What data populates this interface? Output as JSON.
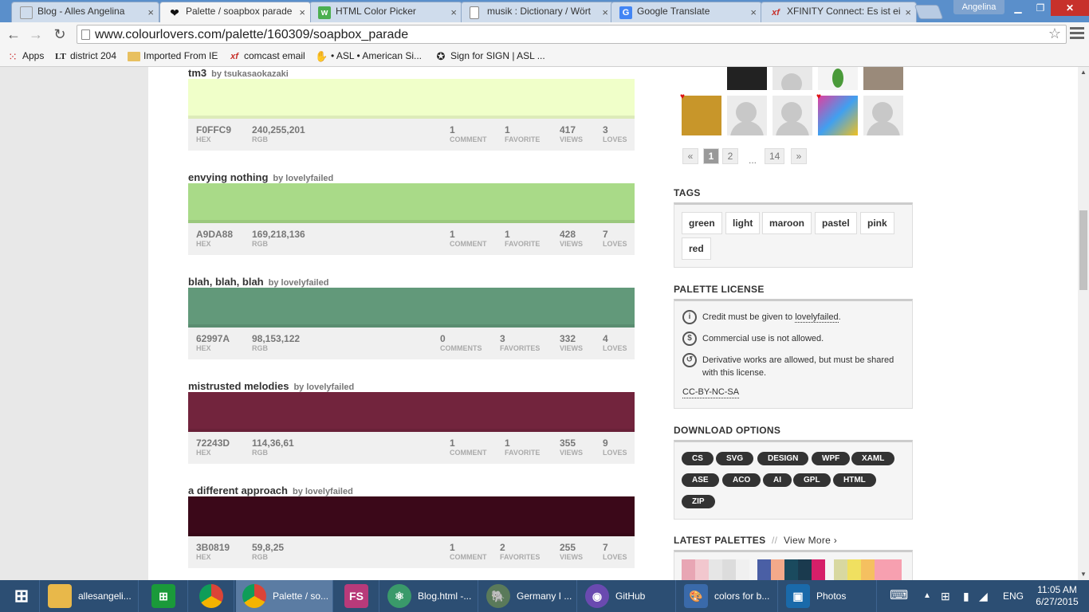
{
  "tabs": [
    {
      "label": "Blog - Alles Angelina",
      "icon": "blogger-icon",
      "color": "#f57d00"
    },
    {
      "label": "Palette / soapbox parade",
      "icon": "heart-icon",
      "color": "#222222",
      "active": true
    },
    {
      "label": "HTML Color Picker",
      "icon": "w3-icon",
      "color": "#4caf50"
    },
    {
      "label": "musik : Dictionary / Wört",
      "icon": "page-icon",
      "color": "#888888"
    },
    {
      "label": "Google Translate",
      "icon": "google-translate-icon",
      "color": "#4285f4"
    },
    {
      "label": "XFINITY Connect: Es ist ei",
      "icon": "xfinity-icon",
      "color": "#c7312b"
    }
  ],
  "profile_name": "Angelina",
  "url": "www.colourlovers.com/palette/160309/soapbox_parade",
  "bookmarks": [
    {
      "label": "Apps",
      "icon": "apps-icon"
    },
    {
      "label": "district 204",
      "icon": "lt-icon"
    },
    {
      "label": "Imported From IE",
      "icon": "folder-icon"
    },
    {
      "label": "comcast email",
      "icon": "xfinity-icon"
    },
    {
      "label": "• ASL • American Si...",
      "icon": "asl-hand-icon"
    },
    {
      "label": "Sign for SIGN | ASL ...",
      "icon": "sign-icon"
    }
  ],
  "colors": [
    {
      "name": "tm3",
      "by": "by",
      "author": "tsukasaokazaki",
      "hex": "F0FFC9",
      "rgb": "240,255,201",
      "swatch": "#F0FFC9",
      "comments": "1",
      "comments_label": "COMMENT",
      "favorites": "1",
      "favorites_label": "FAVORITE",
      "views": "417",
      "loves": "3"
    },
    {
      "name": "envying nothing",
      "by": "by",
      "author": "lovelyfailed",
      "hex": "A9DA88",
      "rgb": "169,218,136",
      "swatch": "#A9DA88",
      "comments": "1",
      "comments_label": "COMMENT",
      "favorites": "1",
      "favorites_label": "FAVORITE",
      "views": "428",
      "loves": "7"
    },
    {
      "name": "blah, blah, blah",
      "by": "by",
      "author": "lovelyfailed",
      "hex": "62997A",
      "rgb": "98,153,122",
      "swatch": "#62997A",
      "comments": "0",
      "comments_label": "COMMENTS",
      "favorites": "3",
      "favorites_label": "FAVORITES",
      "views": "332",
      "loves": "4"
    },
    {
      "name": "mistrusted melodies",
      "by": "by",
      "author": "lovelyfailed",
      "hex": "72243D",
      "rgb": "114,36,61",
      "swatch": "#72243D",
      "comments": "1",
      "comments_label": "COMMENT",
      "favorites": "1",
      "favorites_label": "FAVORITE",
      "views": "355",
      "loves": "9"
    },
    {
      "name": "a different approach",
      "by": "by",
      "author": "lovelyfailed",
      "hex": "3B0819",
      "rgb": "59,8,25",
      "swatch": "#3B0819",
      "comments": "1",
      "comments_label": "COMMENT",
      "favorites": "2",
      "favorites_label": "FAVORITES",
      "views": "255",
      "loves": "7"
    }
  ],
  "stat_labels": {
    "hex": "HEX",
    "rgb": "RGB",
    "views": "VIEWS",
    "loves": "LOVES"
  },
  "pagination": {
    "prev": "«",
    "pages": [
      "1",
      "2"
    ],
    "ellipsis": "...",
    "last": "14",
    "next": "»",
    "current": "1"
  },
  "tags_title": "TAGS",
  "tags": [
    "green",
    "light",
    "maroon",
    "pastel",
    "pink",
    "red"
  ],
  "license": {
    "title": "PALETTE LICENSE",
    "credit_prefix": "Credit must be given to",
    "credit_author": "lovelyfailed",
    "credit_suffix": ".",
    "commercial": "Commercial use is not allowed.",
    "derivative_line1": "Derivative works are allowed, but must be shared",
    "derivative_line2": "with this license.",
    "code": "CC-BY-NC-SA"
  },
  "download": {
    "title": "DOWNLOAD OPTIONS",
    "formats": [
      "CS",
      "SVG",
      "DESIGN",
      "WPF",
      "XAML",
      "ASE",
      "ACO",
      "AI",
      "GPL",
      "HTML",
      "ZIP"
    ]
  },
  "latest": {
    "title": "LATEST PALETTES",
    "separator": "//",
    "view_more": "View More ›"
  },
  "latest_palette_colors": [
    [
      "#e8a6b4",
      "#f2c7ce",
      "#e6e6e6",
      "#dcdcdc",
      "#f0f0f0"
    ],
    [
      "#4a5fa5",
      "#f3a98a",
      "#1a4a5e",
      "#1a3a4e",
      "#d61f69"
    ],
    [
      "#d8d8a0",
      "#f0e060",
      "#f5c060",
      "#f7a0b0",
      "#f7a0b0"
    ]
  ],
  "taskbar": [
    {
      "label": "",
      "icon": "windows-start-icon"
    },
    {
      "label": "allesangeli...",
      "icon": "folder-icon",
      "color": "#e8b84a"
    },
    {
      "label": "",
      "icon": "store-icon",
      "color": "#1a9a3a"
    },
    {
      "label": "",
      "icon": "chrome-icon",
      "color": "#f0c040"
    },
    {
      "label": "Palette / so...",
      "icon": "chrome-icon",
      "color": "#ffffff",
      "active": true
    },
    {
      "label": "",
      "icon": "fs-icon",
      "color": "#b83a7a",
      "text": "FS"
    },
    {
      "label": "Blog.html -...",
      "icon": "atom-icon",
      "color": "#3a9a6a"
    },
    {
      "label": "Germany I ...",
      "icon": "evernote-icon",
      "color": "#5a7a5a"
    },
    {
      "label": "GitHub",
      "icon": "github-icon",
      "color": "#6a4ab0"
    },
    {
      "label": "colors for b...",
      "icon": "paint-icon",
      "color": "#3a6aaa"
    },
    {
      "label": "Photos",
      "icon": "photos-icon",
      "color": "#1a6aaa"
    }
  ],
  "tray": {
    "lang": "ENG",
    "time": "11:05 AM",
    "date": "6/27/2015"
  }
}
